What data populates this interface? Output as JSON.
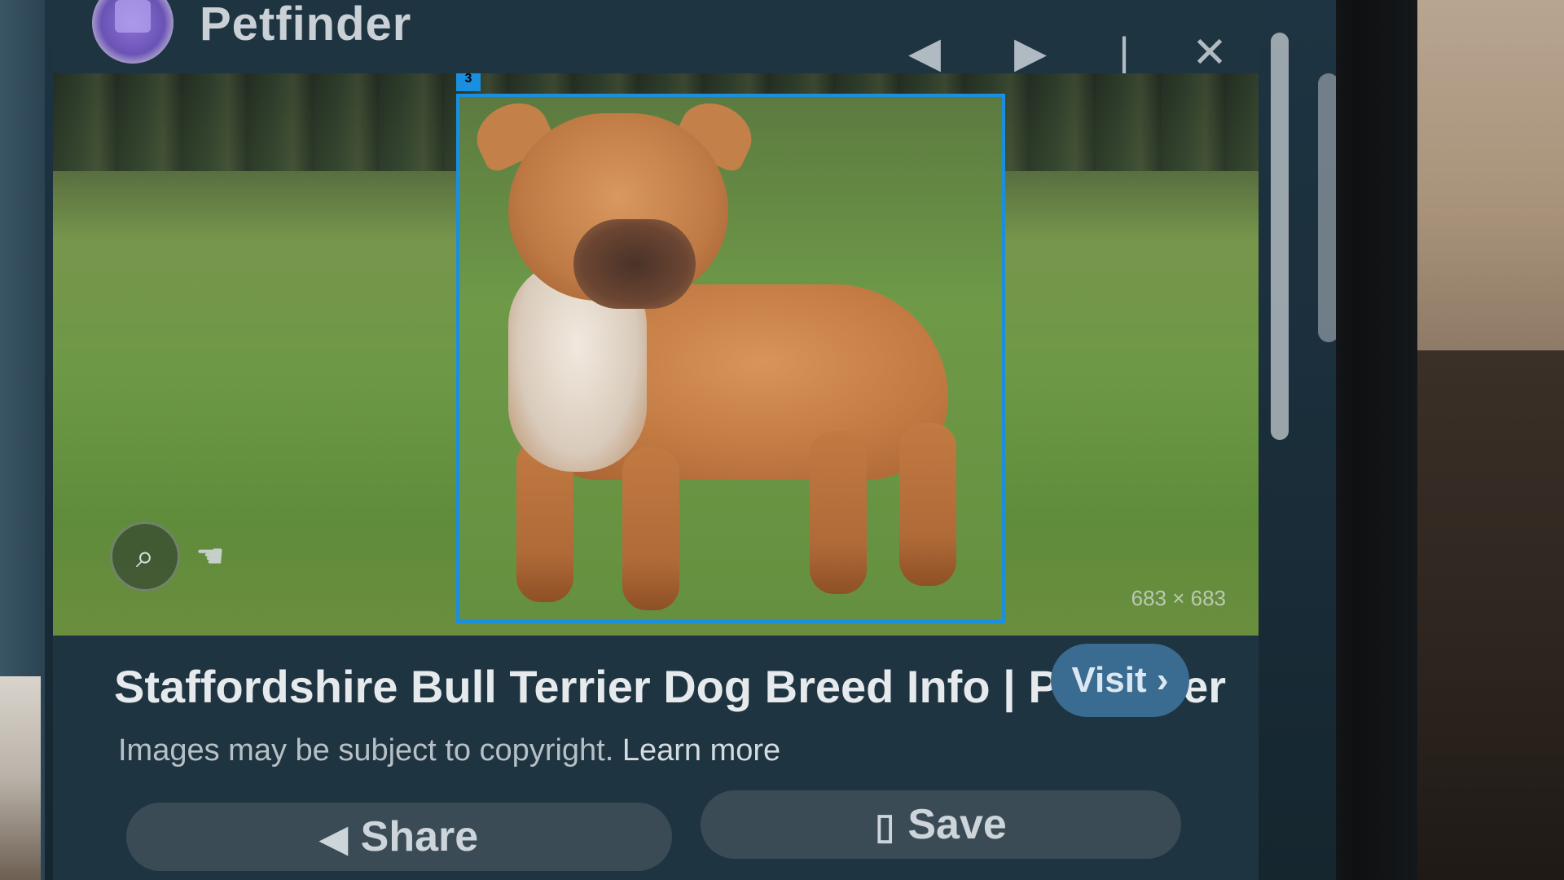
{
  "header": {
    "site_name": "Petfinder",
    "nav": {
      "prev_icon": "◀",
      "next_icon": "▶",
      "divider": "|",
      "close_icon": "✕"
    }
  },
  "image": {
    "marker_label": "3",
    "dimensions": "683 × 683"
  },
  "result": {
    "title": "Staffordshire Bull Terrier Dog Breed Info | Petfinder",
    "copyright_text": "Images may be subject to copyright.",
    "learn_more": "Learn more",
    "visit_label": "Visit",
    "share_label": "Share",
    "save_label": "Save"
  },
  "colors": {
    "selection_box": "#1a8fe0",
    "visit_button": "#3a6b90",
    "action_button": "#3a4b55"
  }
}
